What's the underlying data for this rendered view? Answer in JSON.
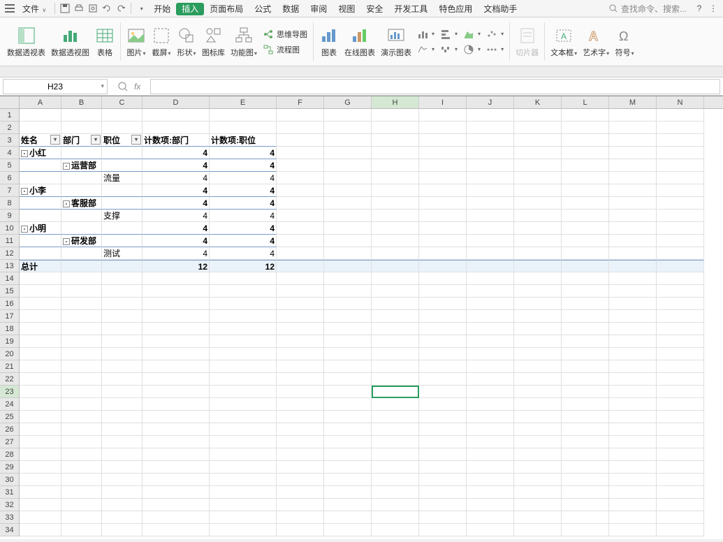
{
  "menubar": {
    "file": "文件",
    "tabs": [
      "开始",
      "插入",
      "页面布局",
      "公式",
      "数据",
      "审阅",
      "视图",
      "安全",
      "开发工具",
      "特色应用",
      "文档助手"
    ],
    "active_tab_index": 1,
    "search_placeholder": "查找命令、搜索..."
  },
  "ribbon": {
    "pivot_table": "数据透视表",
    "pivot_chart": "数据透视图",
    "table": "表格",
    "picture": "图片",
    "screenshot": "截屏",
    "shapes": "形状",
    "icons": "图标库",
    "smartart": "功能图",
    "mindmap": "思维导图",
    "flowchart": "流程图",
    "chart": "图表",
    "online_chart": "在线图表",
    "demo_chart": "演示图表",
    "slicer": "切片器",
    "textbox": "文本框",
    "wordart": "艺术字",
    "symbol": "符号"
  },
  "namebox": "H23",
  "columns": [
    {
      "l": "A",
      "w": 60
    },
    {
      "l": "B",
      "w": 58
    },
    {
      "l": "C",
      "w": 58
    },
    {
      "l": "D",
      "w": 96
    },
    {
      "l": "E",
      "w": 96
    },
    {
      "l": "F",
      "w": 68
    },
    {
      "l": "G",
      "w": 68
    },
    {
      "l": "H",
      "w": 68
    },
    {
      "l": "I",
      "w": 68
    },
    {
      "l": "J",
      "w": 68
    },
    {
      "l": "K",
      "w": 68
    },
    {
      "l": "L",
      "w": 68
    },
    {
      "l": "M",
      "w": 68
    },
    {
      "l": "N",
      "w": 68
    }
  ],
  "selected_col": "H",
  "selected_row": 23,
  "pivot": {
    "headers": {
      "name": "姓名",
      "dept": "部门",
      "pos": "职位",
      "count_dept": "计数项:部门",
      "count_pos": "计数项:职位"
    },
    "rows": [
      {
        "type": "name",
        "a": "小红",
        "d": "4",
        "e": "4"
      },
      {
        "type": "dept",
        "b": "运营部",
        "d": "4",
        "e": "4"
      },
      {
        "type": "pos",
        "c": "流量",
        "d": "4",
        "e": "4"
      },
      {
        "type": "name",
        "a": "小李",
        "d": "4",
        "e": "4"
      },
      {
        "type": "dept",
        "b": "客服部",
        "d": "4",
        "e": "4"
      },
      {
        "type": "pos",
        "c": "支撑",
        "d": "4",
        "e": "4"
      },
      {
        "type": "name",
        "a": "小明",
        "d": "4",
        "e": "4"
      },
      {
        "type": "dept",
        "b": "研发部",
        "d": "4",
        "e": "4"
      },
      {
        "type": "pos",
        "c": "测试",
        "d": "4",
        "e": "4"
      }
    ],
    "total": {
      "label": "总计",
      "d": "12",
      "e": "12"
    }
  },
  "row_count_visible": 34
}
